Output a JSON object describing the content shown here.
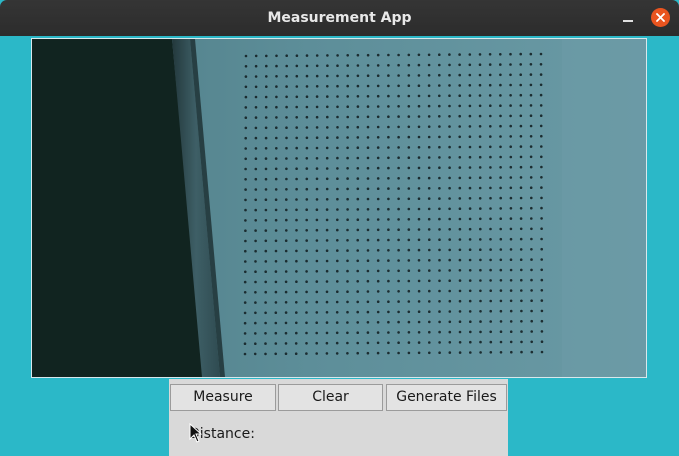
{
  "window": {
    "title": "Measurement App"
  },
  "camera": {
    "dot_grid_columns": 30,
    "dot_grid_rows": 30
  },
  "controls": {
    "measure_label": "Measure",
    "clear_label": "Clear",
    "generate_label": "Generate Files",
    "distance_label": "Distance:"
  },
  "icons": {
    "minimize": "minimize-icon",
    "close": "close-icon",
    "cursor": "mouse-pointer-icon"
  },
  "colors": {
    "desktop_bg": "#2bb8c8",
    "titlebar": "#2c2c2c",
    "close_button": "#e9541f",
    "panel_bg": "#d9d9d9"
  }
}
